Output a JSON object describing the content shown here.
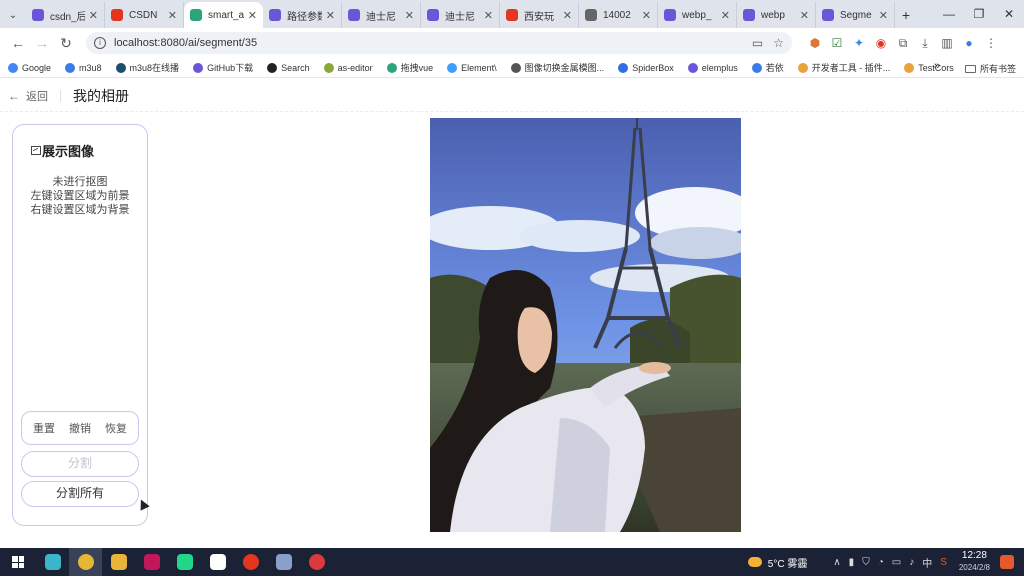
{
  "browser": {
    "tabs": [
      {
        "title": "csdn_后",
        "favicon_color": "#6b56d8",
        "active": false
      },
      {
        "title": "CSDN",
        "favicon_color": "#e2361f",
        "active": false
      },
      {
        "title": "smart_a",
        "favicon_color": "#2aa579",
        "active": true
      },
      {
        "title": "路径参数",
        "favicon_color": "#6b56d8",
        "active": false
      },
      {
        "title": "迪士尼",
        "favicon_color": "#6b56d8",
        "active": false
      },
      {
        "title": "迪士尼",
        "favicon_color": "#6b56d8",
        "active": false
      },
      {
        "title": "西安玩",
        "favicon_color": "#e2361f",
        "active": false
      },
      {
        "title": "14002",
        "favicon_color": "#666666",
        "active": false
      },
      {
        "title": "webp_",
        "favicon_color": "#6b56d8",
        "active": false
      },
      {
        "title": "webp",
        "favicon_color": "#6b56d8",
        "active": false
      },
      {
        "title": "Segme",
        "favicon_color": "#6b56d8",
        "active": false
      }
    ],
    "new_tab": "+",
    "url": "localhost:8080/ai/segment/35",
    "bookmarks": [
      {
        "label": "Google",
        "color": "#4285f4"
      },
      {
        "label": "m3u8",
        "color": "#3b7be8"
      },
      {
        "label": "m3u8在线播",
        "color": "#1d4d6b"
      },
      {
        "label": "GitHub下载",
        "color": "#6b56d8"
      },
      {
        "label": "Search",
        "color": "#222222"
      },
      {
        "label": "as-editor",
        "color": "#8aa83a"
      },
      {
        "label": "拖拽vue",
        "color": "#2aa579"
      },
      {
        "label": "Element\\",
        "color": "#409eff"
      },
      {
        "label": "图像切换金属模图...",
        "color": "#555555"
      },
      {
        "label": "SpiderBox",
        "color": "#2f6fe0"
      },
      {
        "label": "elemplus",
        "color": "#6b56d8"
      },
      {
        "label": "若依",
        "color": "#3b7be8"
      },
      {
        "label": "开发者工具 - 插件...",
        "color": "#e8a33a"
      },
      {
        "label": "TestCors",
        "color": "#e8a33a"
      }
    ],
    "bookmarks_more": "»",
    "bookmarks_folder": "所有书签"
  },
  "header": {
    "back_label": "返回",
    "title": "我的相册"
  },
  "panel": {
    "title": "展示图像",
    "hint_lines": [
      "未进行抠图",
      "左键设置区域为前景",
      "右键设置区域为背景"
    ],
    "buttons": {
      "reset": "重置",
      "undo": "撤销",
      "redo": "恢复",
      "split": "分割",
      "split_all": "分割所有"
    }
  },
  "taskbar": {
    "weather": "5°C 雾霾",
    "ime": "中",
    "time": "12:28",
    "date": "2024/2/8"
  }
}
